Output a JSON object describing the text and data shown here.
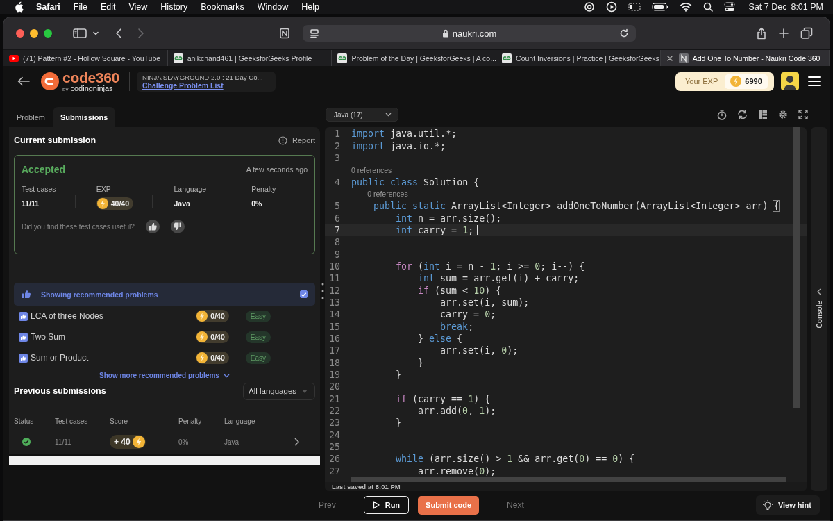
{
  "menu_bar": {
    "app": "Safari",
    "menus": [
      "File",
      "Edit",
      "View",
      "History",
      "Bookmarks",
      "Window",
      "Help"
    ],
    "date": "Sat 7 Dec",
    "time": "8:01 PM"
  },
  "browser": {
    "address": "naukri.com",
    "tabs": [
      {
        "title": "(71) Pattern #2 - Hollow Square - YouTube",
        "kind": "video",
        "selected": false
      },
      {
        "title": "anikchand461 | GeeksforGeeks Profile",
        "kind": "site",
        "selected": false
      },
      {
        "title": "Problem of the Day | GeeksforGeeks | A co...",
        "kind": "site",
        "selected": false
      },
      {
        "title": "Count Inversions | Practice | GeeksforGeeks",
        "kind": "site",
        "selected": false
      },
      {
        "title": "Add One To Number - Naukri Code 360",
        "kind": "page",
        "selected": true
      }
    ]
  },
  "app_header": {
    "logo": "code360",
    "logo_by": "by",
    "logo_brand": "codingninjas",
    "challenge": "NINJA SLAYGROUND 2.0 : 21 Day Co...",
    "challenge_link": "Challenge Problem List",
    "exp_label": "Your EXP",
    "exp_value": "6990"
  },
  "panel_tabs": [
    {
      "label": "Problem",
      "selected": false
    },
    {
      "label": "Submissions",
      "selected": true
    }
  ],
  "current_submission": {
    "title": "Current submission",
    "report": "Report",
    "status": "Accepted",
    "time": "A few seconds ago",
    "stats": [
      {
        "label": "Test cases",
        "value": "11/11",
        "kind": "text"
      },
      {
        "label": "EXP",
        "value": "40/40",
        "kind": "exp"
      },
      {
        "label": "Language",
        "value": "Java",
        "kind": "text"
      },
      {
        "label": "Penalty",
        "value": "0%",
        "kind": "text"
      }
    ],
    "feedback": "Did you find these test cases useful?"
  },
  "recommended": {
    "label": "Showing recommended problems",
    "checked": true,
    "problems": [
      {
        "title": "LCA of three Nodes",
        "exp": "0/40",
        "difficulty": "Easy"
      },
      {
        "title": "Two Sum",
        "exp": "0/40",
        "difficulty": "Easy"
      },
      {
        "title": "Sum or Product",
        "exp": "0/40",
        "difficulty": "Easy"
      }
    ],
    "show_more": "Show more recommended problems"
  },
  "previous_submissions": {
    "title": "Previous submissions",
    "filter": "All languages",
    "columns": [
      "Status",
      "Test cases",
      "Score",
      "Penalty",
      "Language"
    ],
    "rows": [
      {
        "kind": "accepted",
        "test_cases": "11/11",
        "score": "+ 40",
        "penalty": "0%",
        "language": "Java"
      }
    ]
  },
  "editor": {
    "language": "Java (17)",
    "last_saved": "Last saved at 8:01 PM",
    "console": "Console",
    "lines": [
      {
        "number": "1",
        "current": false,
        "tokens": [
          {
            "kind": "kw",
            "text": "import"
          },
          {
            "kind": "plain",
            "text": " java.util.*;"
          }
        ]
      },
      {
        "number": "2",
        "current": false,
        "tokens": [
          {
            "kind": "kw",
            "text": "import"
          },
          {
            "kind": "plain",
            "text": " java.io.*;"
          }
        ]
      },
      {
        "number": "3",
        "current": false
      },
      {
        "number": "4",
        "current": false,
        "lens": "0 references",
        "tokens": [
          {
            "kind": "kw",
            "text": "public"
          },
          {
            "kind": "kw",
            "text": " class"
          },
          {
            "kind": "plain",
            "text": " Solution {"
          }
        ]
      },
      {
        "number": "5",
        "current": false,
        "lens": "0 references",
        "tokens": [
          {
            "kind": "kw",
            "text": "    public"
          },
          {
            "kind": "kw",
            "text": " static"
          },
          {
            "kind": "plain",
            "text": " ArrayList<Integer> addOneToNumber(ArrayList<Integer> arr) "
          },
          {
            "kind": "match",
            "text": "{"
          }
        ]
      },
      {
        "number": "6",
        "current": false,
        "tokens": [
          {
            "kind": "kw",
            "text": "        int"
          },
          {
            "kind": "plain",
            "text": " n = arr.size();"
          }
        ]
      },
      {
        "number": "7",
        "current": true,
        "tokens": [
          {
            "kind": "kw",
            "text": "        int"
          },
          {
            "kind": "plain",
            "text": " carry = "
          },
          {
            "kind": "num",
            "text": "1"
          },
          {
            "kind": "plain",
            "text": ";"
          }
        ]
      },
      {
        "number": "8",
        "current": false
      },
      {
        "number": "9",
        "current": false
      },
      {
        "number": "10",
        "current": false,
        "tokens": [
          {
            "kind": "ctl",
            "text": "        for"
          },
          {
            "kind": "plain",
            "text": " ("
          },
          {
            "kind": "kw",
            "text": "int"
          },
          {
            "kind": "plain",
            "text": " i = n - "
          },
          {
            "kind": "num",
            "text": "1"
          },
          {
            "kind": "plain",
            "text": "; i >= "
          },
          {
            "kind": "num",
            "text": "0"
          },
          {
            "kind": "plain",
            "text": "; i--) {"
          }
        ]
      },
      {
        "number": "11",
        "current": false,
        "tokens": [
          {
            "kind": "kw",
            "text": "            int"
          },
          {
            "kind": "plain",
            "text": " sum = arr.get(i) + carry;"
          }
        ]
      },
      {
        "number": "12",
        "current": false,
        "tokens": [
          {
            "kind": "ctl",
            "text": "            if"
          },
          {
            "kind": "plain",
            "text": " (sum < "
          },
          {
            "kind": "num",
            "text": "10"
          },
          {
            "kind": "plain",
            "text": ") {"
          }
        ]
      },
      {
        "number": "13",
        "current": false,
        "tokens": [
          {
            "kind": "plain",
            "text": "                arr.set(i, sum);"
          }
        ]
      },
      {
        "number": "14",
        "current": false,
        "tokens": [
          {
            "kind": "plain",
            "text": "                carry = "
          },
          {
            "kind": "num",
            "text": "0"
          },
          {
            "kind": "plain",
            "text": ";"
          }
        ]
      },
      {
        "number": "15",
        "current": false,
        "tokens": [
          {
            "kind": "kw",
            "text": "                break"
          },
          {
            "kind": "plain",
            "text": ";"
          }
        ]
      },
      {
        "number": "16",
        "current": false,
        "tokens": [
          {
            "kind": "plain",
            "text": "            } "
          },
          {
            "kind": "kw",
            "text": "else"
          },
          {
            "kind": "plain",
            "text": " {"
          }
        ]
      },
      {
        "number": "17",
        "current": false,
        "tokens": [
          {
            "kind": "plain",
            "text": "                arr.set(i, "
          },
          {
            "kind": "num",
            "text": "0"
          },
          {
            "kind": "plain",
            "text": ");"
          }
        ]
      },
      {
        "number": "18",
        "current": false,
        "tokens": [
          {
            "kind": "plain",
            "text": "            }"
          }
        ]
      },
      {
        "number": "19",
        "current": false,
        "tokens": [
          {
            "kind": "plain",
            "text": "        }"
          }
        ]
      },
      {
        "number": "20",
        "current": false
      },
      {
        "number": "21",
        "current": false,
        "tokens": [
          {
            "kind": "ctl",
            "text": "        if"
          },
          {
            "kind": "plain",
            "text": " (carry == "
          },
          {
            "kind": "num",
            "text": "1"
          },
          {
            "kind": "plain",
            "text": ") {"
          }
        ]
      },
      {
        "number": "22",
        "current": false,
        "tokens": [
          {
            "kind": "plain",
            "text": "            arr.add("
          },
          {
            "kind": "num",
            "text": "0"
          },
          {
            "kind": "plain",
            "text": ", "
          },
          {
            "kind": "num",
            "text": "1"
          },
          {
            "kind": "plain",
            "text": ");"
          }
        ]
      },
      {
        "number": "23",
        "current": false,
        "tokens": [
          {
            "kind": "plain",
            "text": "        }"
          }
        ]
      },
      {
        "number": "24",
        "current": false
      },
      {
        "number": "25",
        "current": false
      },
      {
        "number": "26",
        "current": false,
        "tokens": [
          {
            "kind": "kw",
            "text": "        while"
          },
          {
            "kind": "plain",
            "text": " (arr.size() > "
          },
          {
            "kind": "num",
            "text": "1"
          },
          {
            "kind": "plain",
            "text": " && arr.get("
          },
          {
            "kind": "num",
            "text": "0"
          },
          {
            "kind": "plain",
            "text": ") == "
          },
          {
            "kind": "num",
            "text": "0"
          },
          {
            "kind": "plain",
            "text": ") {"
          }
        ]
      },
      {
        "number": "27",
        "current": false,
        "tokens": [
          {
            "kind": "plain",
            "text": "            arr.remove("
          },
          {
            "kind": "num",
            "text": "0"
          },
          {
            "kind": "plain",
            "text": ");"
          }
        ]
      }
    ]
  },
  "footer": {
    "prev": "Prev",
    "run": "Run",
    "submit": "Submit code",
    "next": "Next",
    "hint": "View hint"
  }
}
